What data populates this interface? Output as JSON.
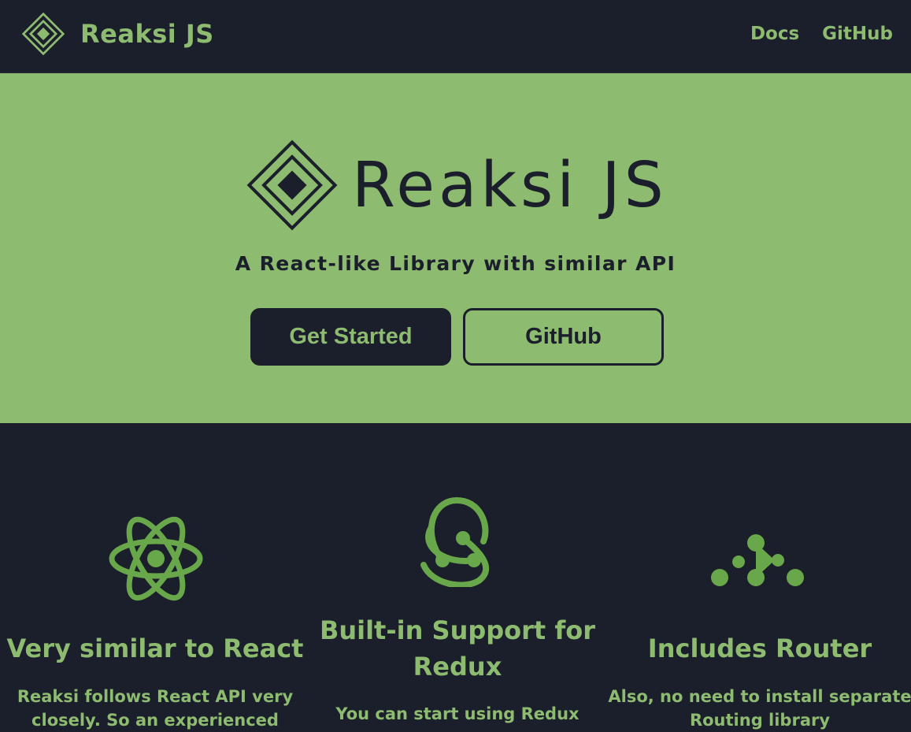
{
  "header": {
    "brand": "Reaksi JS",
    "nav": {
      "docs": "Docs",
      "github": "GitHub"
    }
  },
  "hero": {
    "title": "Reaksi JS",
    "tagline": "A React-like Library with similar API",
    "primary_button": "Get Started",
    "secondary_button": "GitHub"
  },
  "features": [
    {
      "icon": "react-atom-icon",
      "title": "Very similar to React",
      "description": "Reaksi follows React API very closely. So an experienced"
    },
    {
      "icon": "redux-icon",
      "title": "Built-in Support for Redux",
      "description": "You can start using Redux"
    },
    {
      "icon": "router-icon",
      "title": "Includes Router",
      "description": "Also, no need to install separate Routing library"
    }
  ],
  "colors": {
    "background": "#1b1e2b",
    "accent": "#8dbb6f",
    "icon_green": "#69a84a"
  }
}
